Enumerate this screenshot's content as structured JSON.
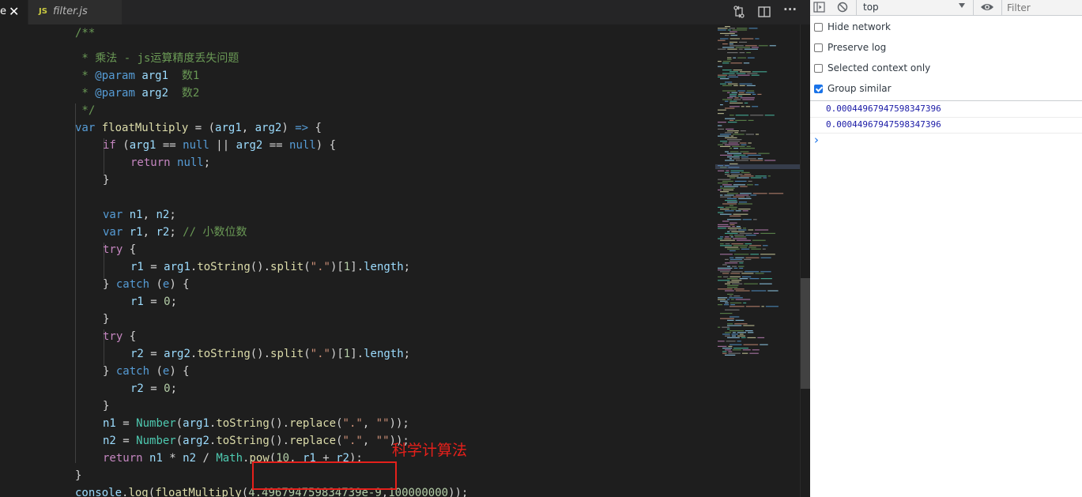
{
  "editor": {
    "tabs": [
      {
        "label": "e",
        "close": "✕"
      },
      {
        "icon_text": "JS",
        "label": "filter.js"
      }
    ],
    "toolbar_icons": [
      "compare-changes-icon",
      "split-editor-icon",
      "more-actions-icon"
    ],
    "more_glyph": "···",
    "code_lines": [
      {
        "text": "/**"
      },
      {
        "text": " * 乘法 - js运算精度丢失问题"
      },
      {
        "text": " * @param arg1  数1"
      },
      {
        "text": " * @param arg2  数2"
      },
      {
        "text": " */"
      },
      {
        "text": "var floatMultiply = (arg1, arg2) => {"
      },
      {
        "text": "if (arg1 == null || arg2 == null) {"
      },
      {
        "text": "return null;"
      },
      {
        "text": "}"
      },
      {
        "text": ""
      },
      {
        "text": "var n1, n2;"
      },
      {
        "text": "var r1, r2; // 小数位数"
      },
      {
        "text": "try {"
      },
      {
        "text": "r1 = arg1.toString().split(\".\")[1].length;"
      },
      {
        "text": "} catch (e) {"
      },
      {
        "text": "r1 = 0;"
      },
      {
        "text": "}"
      },
      {
        "text": "try {"
      },
      {
        "text": "r2 = arg2.toString().split(\".\")[1].length;"
      },
      {
        "text": "} catch (e) {"
      },
      {
        "text": "r2 = 0;"
      },
      {
        "text": "}"
      },
      {
        "text": "n1 = Number(arg1.toString().replace(\".\", \"\"));"
      },
      {
        "text": "n2 = Number(arg2.toString().replace(\".\", \"\"));"
      },
      {
        "text": "return n1 * n2 / Math.pow(10, r1 + r2);"
      },
      {
        "text": "}"
      },
      {
        "text": "console.log(floatMultiply(4.496794759834739e-9,100000000));"
      }
    ],
    "annotation": "科学计算法",
    "highlight_color": "#e5201b"
  },
  "devtools": {
    "context": "top",
    "filter_placeholder": "Filter",
    "options": [
      {
        "label": "Hide network",
        "checked": false
      },
      {
        "label": "Preserve log",
        "checked": false
      },
      {
        "label": "Selected context only",
        "checked": false
      },
      {
        "label": "Group similar",
        "checked": true
      }
    ],
    "messages": [
      "0.00044967947598347396",
      "0.00044967947598347396"
    ],
    "prompt": "›"
  }
}
